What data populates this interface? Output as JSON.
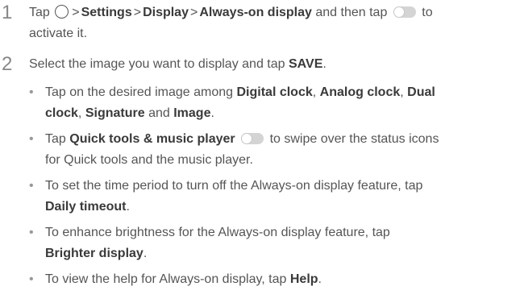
{
  "steps": [
    {
      "number": "1",
      "parts": {
        "tap": "Tap",
        "gt": ">",
        "settings": "Settings",
        "display": "Display",
        "always_on": "Always-on display",
        "then": "and then tap",
        "to": "to",
        "activate": "activate it."
      }
    },
    {
      "number": "2",
      "parts": {
        "pre": "Select the image you want to display and tap",
        "save": "SAVE",
        "dot": "."
      }
    }
  ],
  "bullets": [
    {
      "pre": "Tap on the desired image among",
      "digital": "Digital clock",
      "comma1": ",",
      "analog": "Analog clock",
      "comma2": ",",
      "dual": "Dual",
      "clock": "clock",
      "comma3": ",",
      "signature": "Signature",
      "and": "and",
      "image": "Image",
      "dot": "."
    },
    {
      "tap": "Tap",
      "quick": "Quick tools & music player",
      "post": "to swipe over the status icons",
      "line2": "for Quick tools and the music player."
    },
    {
      "pre": "To set the time period to turn off the Always-on display feature, tap",
      "daily": "Daily timeout",
      "dot": "."
    },
    {
      "pre": "To enhance brightness for the Always-on display feature, tap",
      "brighter": "Brighter display",
      "dot": "."
    },
    {
      "pre": "To view the help for Always-on display, tap",
      "help": "Help",
      "dot": "."
    }
  ],
  "icons": {
    "home": "home-circle-icon",
    "toggle": "toggle-switch-icon"
  },
  "colors": {
    "text": "#555555",
    "bold": "#3a3a3a",
    "step_number": "#888888"
  }
}
